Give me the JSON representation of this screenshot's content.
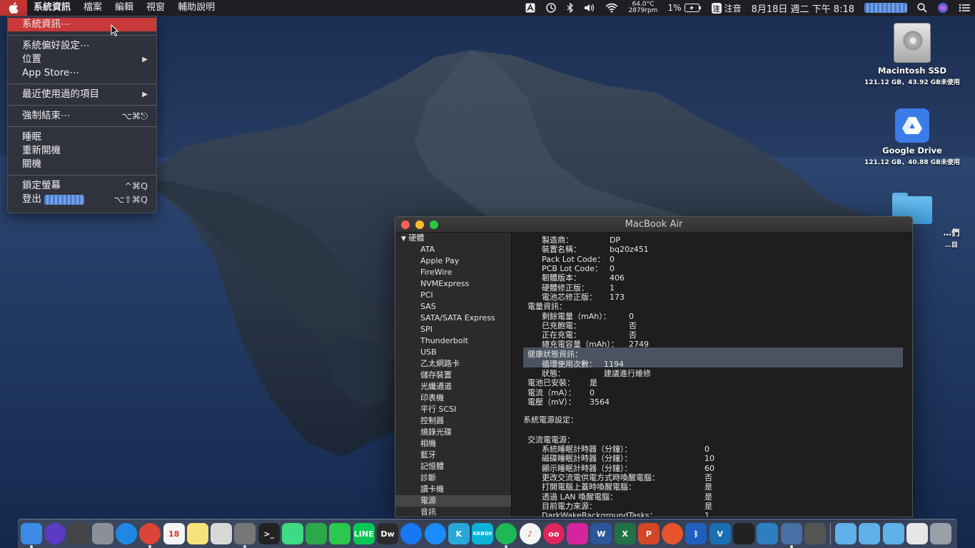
{
  "menubar": {
    "apple_icon": "apple-logo-icon",
    "items": [
      "系統資訊",
      "檔案",
      "編輯",
      "視窗",
      "輔助說明"
    ],
    "status": {
      "temperature": "64.0°C",
      "fan_speed": "2879rpm",
      "battery": "1%",
      "input_method": "注音",
      "input_badge": "注",
      "clock": "8月18日 週二 下午 8:18"
    }
  },
  "apple_menu": {
    "items": [
      {
        "label": "系統資訊⋯",
        "shortcut": ""
      },
      {
        "label": "系統偏好設定⋯",
        "shortcut": ""
      },
      {
        "label": "位置",
        "shortcut": "▶"
      },
      {
        "label": "App Store⋯",
        "shortcut": ""
      },
      {
        "label": "最近使用過的項目",
        "shortcut": "▶"
      },
      {
        "label": "強制結束⋯",
        "shortcut": "⌥⌘⎋"
      },
      {
        "label": "睡眠",
        "shortcut": ""
      },
      {
        "label": "重新開機",
        "shortcut": ""
      },
      {
        "label": "關機",
        "shortcut": ""
      },
      {
        "label": "鎖定螢幕",
        "shortcut": "^⌘Q"
      },
      {
        "label": "登出",
        "shortcut": "⌥⇧⌘Q"
      }
    ]
  },
  "desktop": {
    "icons": [
      {
        "name": "Macintosh SSD",
        "sub": "121.12 GB，43.92 GB未使用"
      },
      {
        "name": "Google Drive",
        "sub": "121.12 GB，40.88 GB未使用"
      },
      {
        "name": "…們",
        "sub": "…目"
      }
    ]
  },
  "window": {
    "title": "MacBook Air",
    "sidebar": {
      "header": "硬體",
      "items": [
        "ATA",
        "Apple Pay",
        "FireWire",
        "NVMExpress",
        "PCI",
        "SAS",
        "SATA/SATA Express",
        "SPI",
        "Thunderbolt",
        "USB",
        "乙太網路卡",
        "儲存裝置",
        "光纖通道",
        "印表機",
        "平行 SCSI",
        "控制器",
        "燒錄光碟",
        "相機",
        "藍牙",
        "記憶體",
        "診斷",
        "讀卡機",
        "電源",
        "音訊"
      ],
      "selected": "電源"
    },
    "content": {
      "device_info": [
        {
          "label": "製造商：",
          "value": "DP"
        },
        {
          "label": "裝置名稱：",
          "value": "bq20z451"
        },
        {
          "label": "Pack Lot Code：",
          "value": "0"
        },
        {
          "label": "PCB Lot Code：",
          "value": "0"
        },
        {
          "label": "韌體版本：",
          "value": "406"
        },
        {
          "label": "硬體修正版：",
          "value": "1"
        },
        {
          "label": "電池芯修正版：",
          "value": "173"
        }
      ],
      "charge_header": "電量資訊：",
      "charge_info": [
        {
          "label": "剩餘電量（mAh）：",
          "value": "0"
        },
        {
          "label": "已充飽電：",
          "value": "否"
        },
        {
          "label": "正在充電：",
          "value": "否"
        },
        {
          "label": "總充電容量（mAh）：",
          "value": "2749"
        }
      ],
      "health_header": "健康狀態資訊：",
      "health_info": [
        {
          "label": "循環使用次數：",
          "value": "1194"
        },
        {
          "label": "狀態：",
          "value": "建議進行維修"
        }
      ],
      "battery_misc": [
        {
          "label": "電池已安裝：",
          "value": "是"
        },
        {
          "label": "電流（mA）：",
          "value": "0"
        },
        {
          "label": "電壓（mV）：",
          "value": "3564"
        }
      ],
      "power_settings_header": "系統電源設定：",
      "ac_header": "交流電電源：",
      "ac_info": [
        {
          "label": "系統睡眠計時器（分鐘）：",
          "value": "0"
        },
        {
          "label": "磁碟睡眠計時器（分鐘）：",
          "value": "10"
        },
        {
          "label": "顯示睡眠計時器（分鐘）：",
          "value": "60"
        },
        {
          "label": "更改交流電供電方式時喚醒電腦：",
          "value": "否"
        },
        {
          "label": "打開電腦上蓋時喚醒電腦：",
          "value": "是"
        },
        {
          "label": "透過 LAN 喚醒電腦：",
          "value": "是"
        },
        {
          "label": "目前電力來源：",
          "value": "是"
        },
        {
          "label": "DarkWakeBackgroundTasks：",
          "value": "1"
        }
      ]
    }
  },
  "dock": {
    "apps": [
      {
        "name": "finder-icon",
        "label": "",
        "color": "#3b8be6",
        "dot": true
      },
      {
        "name": "siri-icon",
        "label": "",
        "color": "#5a3bc2",
        "dot": false
      },
      {
        "name": "mission-control-icon",
        "label": "",
        "color": "#444",
        "dot": false
      },
      {
        "name": "launchpad-icon",
        "label": "",
        "color": "#8a8f9a",
        "dot": false
      },
      {
        "name": "safari-icon",
        "label": "",
        "color": "#1e88e5",
        "dot": false
      },
      {
        "name": "chrome-icon",
        "label": "",
        "color": "#db4437",
        "dot": true
      },
      {
        "name": "calendar-icon",
        "label": "18",
        "color": "#f4f4f4",
        "dot": false
      },
      {
        "name": "notes-icon",
        "label": "",
        "color": "#f7e27a",
        "dot": false
      },
      {
        "name": "screenshot-icon",
        "label": "",
        "color": "#d8d8d8",
        "dot": false
      },
      {
        "name": "system-preferences-icon",
        "label": "",
        "color": "#777",
        "dot": true
      },
      {
        "name": "terminal-icon",
        "label": ">_",
        "color": "#222",
        "dot": false
      },
      {
        "name": "android-studio-icon",
        "label": "",
        "color": "#3ddc84",
        "dot": false
      },
      {
        "name": "cloud-app-icon",
        "label": "",
        "color": "#2aa84a",
        "dot": false
      },
      {
        "name": "facetime-icon",
        "label": "",
        "color": "#2cc74e",
        "dot": false
      },
      {
        "name": "line-icon",
        "label": "LINE",
        "color": "#06c755",
        "dot": false
      },
      {
        "name": "dreamweaver-icon",
        "label": "Dw",
        "color": "#2b2b2b",
        "dot": false
      },
      {
        "name": "messenger-icon",
        "label": "",
        "color": "#1877f2",
        "dot": false
      },
      {
        "name": "shazam-icon",
        "label": "",
        "color": "#1a8cff",
        "dot": false
      },
      {
        "name": "klokki-icon",
        "label": "K",
        "color": "#2aa7d9",
        "dot": false
      },
      {
        "name": "kkbox-icon",
        "label": "KKBOX",
        "color": "#09b4d8",
        "dot": false
      },
      {
        "name": "spotify-icon",
        "label": "",
        "color": "#1db954",
        "dot": true
      },
      {
        "name": "itunes-icon",
        "label": "♪",
        "color": "#f5f5f5",
        "dot": false
      },
      {
        "name": "flickr-icon",
        "label": "oo",
        "color": "#e0245e",
        "dot": false
      },
      {
        "name": "instagram-icon",
        "label": "",
        "color": "#d6249f",
        "dot": false
      },
      {
        "name": "word-icon",
        "label": "W",
        "color": "#2b579a",
        "dot": false
      },
      {
        "name": "excel-icon",
        "label": "X",
        "color": "#217346",
        "dot": false
      },
      {
        "name": "powerpoint-icon",
        "label": "P",
        "color": "#d24726",
        "dot": false
      },
      {
        "name": "remote-desktop-icon",
        "label": "",
        "color": "#e8542b",
        "dot": false
      },
      {
        "name": "bluetooth-icon",
        "label": "ᛒ",
        "color": "#1f5fbf",
        "dot": false
      },
      {
        "name": "vmware-icon",
        "label": "V",
        "color": "#1b6fb4",
        "dot": false
      },
      {
        "name": "activity-monitor-icon",
        "label": "",
        "color": "#222",
        "dot": false
      },
      {
        "name": "preview-icon",
        "label": "",
        "color": "#2e7fbf",
        "dot": false
      },
      {
        "name": "system-info-icon",
        "label": "",
        "color": "#4a6fa5",
        "dot": true
      },
      {
        "name": "airdrop-tool-icon",
        "label": "",
        "color": "#555",
        "dot": false
      }
    ],
    "stacks": [
      {
        "name": "documents-folder-icon",
        "color": "#5fb1e8"
      },
      {
        "name": "downloads-folder-icon",
        "color": "#5fb1e8"
      },
      {
        "name": "applications-folder-icon",
        "color": "#5fb1e8"
      },
      {
        "name": "file-stack-icon",
        "color": "#e6e6e6"
      },
      {
        "name": "trash-icon",
        "color": "#9aa0a8"
      }
    ]
  }
}
